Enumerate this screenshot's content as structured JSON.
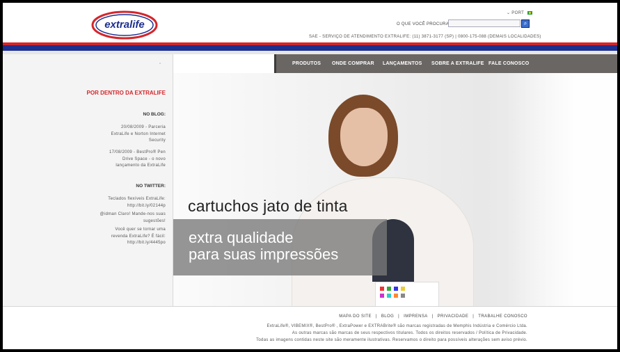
{
  "header": {
    "logo_text": "extralife",
    "language": "PORT",
    "search_label": "O QUE VOCÊ PROCURA?",
    "search_placeholder": "",
    "sac_text": "SAE - SERVIÇO DE ATENDIMENTO EXTRALIFE: (11) 3871-3177 (SP)  |  0800-175-088 (DEMAIS LOCALIDADES)"
  },
  "nav": {
    "items": [
      {
        "label": "PRODUTOS"
      },
      {
        "label": "ONDE COMPRAR"
      },
      {
        "label": "LANÇAMENTOS"
      },
      {
        "label": "SOBRE A EXTRALIFE"
      },
      {
        "label": "FALE CONOSCO"
      }
    ]
  },
  "sidebar": {
    "quote": "“",
    "title": "POR DENTRO DA EXTRALIFE",
    "blog_heading": "NO BLOG:",
    "blog_posts": [
      {
        "line1": "20/08/2009 - Parceria",
        "line2": "ExtraLife e Norton Internet",
        "line3": "Security"
      },
      {
        "line1": "17/08/2009 - BestPro® Pen",
        "line2": "Drive Space - o novo",
        "line3": "lançamento da ExtraLife"
      }
    ],
    "twitter_heading": "NO TWITTER:",
    "tweets": [
      {
        "line1": "Teclados flexíveis ExtraLife:",
        "line2": "http://bit.ly/02144p"
      },
      {
        "line1": "@idman Claro! Mande-nos suas",
        "line2": "sugestões!"
      },
      {
        "line1": "Você quer se tornar uma",
        "line2": "revenda ExtraLife? É fácil:",
        "line3": "http://bit.ly/4445po"
      }
    ]
  },
  "hero": {
    "headline": "cartuchos jato de tinta",
    "line_a": "extra qualidade",
    "line_b": "para suas impressões"
  },
  "footer": {
    "links": [
      "MAPA DO SITE",
      "BLOG",
      "IMPRENSA",
      "PRIVACIDADE",
      "TRABALHE CONOSCO"
    ],
    "line1": "ExtraLife®, VIBEMIX®, BestPro® , ExtraPower e EXTRABrite® são marcas registradas de Memphis Indústria e Comércio Ltda.",
    "line2": "As outras marcas são marcas de seus respectivos titulares. Todos os direitos reservados / Política de Privacidade.",
    "line3": "Todas as imagens contidas neste site são meramente ilustrativas. Reservamos o direito para possíveis alterações sem aviso prévio."
  },
  "colors": {
    "brand_red": "#d4262b",
    "brand_blue": "#1d2f8f",
    "nav_bg": "#6a6664"
  }
}
